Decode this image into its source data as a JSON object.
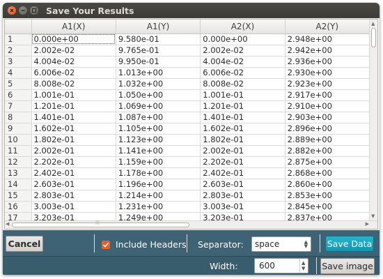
{
  "window": {
    "title": "Save Your Results"
  },
  "table": {
    "columns": [
      "A1(X)",
      "A1(Y)",
      "A2(X)",
      "A2(Y)"
    ],
    "rows": [
      [
        "1",
        "0.000e+00",
        "9.580e-01",
        "0.000e+00",
        "2.948e+00"
      ],
      [
        "2",
        "2.002e-02",
        "9.765e-01",
        "2.002e-02",
        "2.942e+00"
      ],
      [
        "3",
        "4.004e-02",
        "9.950e-01",
        "4.004e-02",
        "2.936e+00"
      ],
      [
        "4",
        "6.006e-02",
        "1.013e+00",
        "6.006e-02",
        "2.930e+00"
      ],
      [
        "5",
        "8.008e-02",
        "1.032e+00",
        "8.008e-02",
        "2.923e+00"
      ],
      [
        "6",
        "1.001e-01",
        "1.050e+00",
        "1.001e-01",
        "2.917e+00"
      ],
      [
        "7",
        "1.201e-01",
        "1.069e+00",
        "1.201e-01",
        "2.910e+00"
      ],
      [
        "8",
        "1.401e-01",
        "1.087e+00",
        "1.401e-01",
        "2.903e+00"
      ],
      [
        "9",
        "1.602e-01",
        "1.105e+00",
        "1.602e-01",
        "2.896e+00"
      ],
      [
        "10",
        "1.802e-01",
        "1.123e+00",
        "1.802e-01",
        "2.889e+00"
      ],
      [
        "11",
        "2.002e-01",
        "1.141e+00",
        "2.002e-01",
        "2.882e+00"
      ],
      [
        "12",
        "2.202e-01",
        "1.159e+00",
        "2.202e-01",
        "2.875e+00"
      ],
      [
        "13",
        "2.402e-01",
        "1.178e+00",
        "2.402e-01",
        "2.868e+00"
      ],
      [
        "14",
        "2.603e-01",
        "1.196e+00",
        "2.603e-01",
        "2.860e+00"
      ],
      [
        "15",
        "2.803e-01",
        "1.214e+00",
        "2.803e-01",
        "2.853e+00"
      ],
      [
        "16",
        "3.003e-01",
        "1.231e+00",
        "3.003e-01",
        "2.845e+00"
      ],
      [
        "17",
        "3.203e-01",
        "1.249e+00",
        "3.203e-01",
        "2.837e+00"
      ]
    ]
  },
  "controls": {
    "cancel_label": "Cancel",
    "include_headers_label": "Include Headers",
    "include_headers_checked": true,
    "separator_label": "Separator:",
    "separator_value": "space",
    "save_data_label": "Save Data",
    "width_label": "Width:",
    "width_value": "600",
    "save_image_label": "Save image"
  },
  "colors": {
    "titlebar": "#3c3b37",
    "panel": "#3d6375",
    "primary_button": "#1ea2bd",
    "checkbox": "#e5632a"
  },
  "icons": {
    "close": "close-icon",
    "minimize": "minimize-icon",
    "maximize": "maximize-icon",
    "checkmark": "checkmark-icon",
    "spinner_arrows": "spinner-arrows-icon"
  }
}
